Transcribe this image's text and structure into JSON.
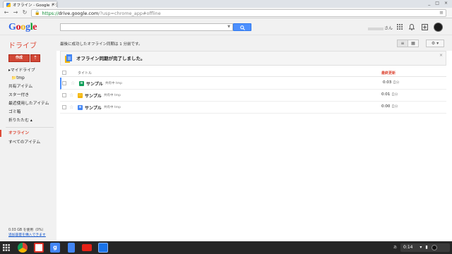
{
  "browser": {
    "tab_title": "オフライン - Google ドライブ",
    "tab_close": "×",
    "url_scheme": "https://",
    "url_host": "drive.google.com",
    "url_path": "/?usp=chrome_app#offline",
    "window_controls": [
      "_",
      "□",
      "×"
    ]
  },
  "header": {
    "logo": "Google",
    "user_suffix": "さん"
  },
  "page": {
    "title": "ドライブ",
    "sync_status": "最後に成功したオフライン同期は 1 分前です。"
  },
  "sidebar": {
    "create_label": "作成",
    "items": [
      {
        "label": "▸マイドライブ"
      },
      {
        "label": "📁tmp"
      },
      {
        "label": "共有アイテム"
      },
      {
        "label": "スター付き"
      },
      {
        "label": "最近使用したアイテム"
      },
      {
        "label": "ゴミ箱"
      },
      {
        "label": "折りたたむ ▴"
      },
      {
        "label": "オフライン"
      },
      {
        "label": "すべてのアイテム"
      }
    ],
    "quota_used": "0.03 GB を使用（0%）",
    "quota_link": "追加容量を購入できます"
  },
  "notice": {
    "message": "オフライン同期が完了しました。",
    "close": "×"
  },
  "table": {
    "col_title": "タイトル",
    "col_modified": "最終更新",
    "rows": [
      {
        "name": "サンプル",
        "meta": "共有中  tmp",
        "icon_color": "#0f9d58",
        "icon_glyph": "≡",
        "modified": "0:03",
        "who": "自分"
      },
      {
        "name": "サンプル",
        "meta": "共有中  tmp",
        "icon_color": "#f4b400",
        "icon_glyph": "▭",
        "modified": "0:01",
        "who": "自分"
      },
      {
        "name": "サンプル",
        "meta": "共有中  tmp",
        "icon_color": "#4285f4",
        "icon_glyph": "≡",
        "modified": "0:00",
        "who": "自分"
      }
    ]
  },
  "tray": {
    "ime": "あ",
    "time": "0:14"
  },
  "colors": {
    "accent_red": "#dd4b39",
    "search_blue": "#4d90fe"
  }
}
